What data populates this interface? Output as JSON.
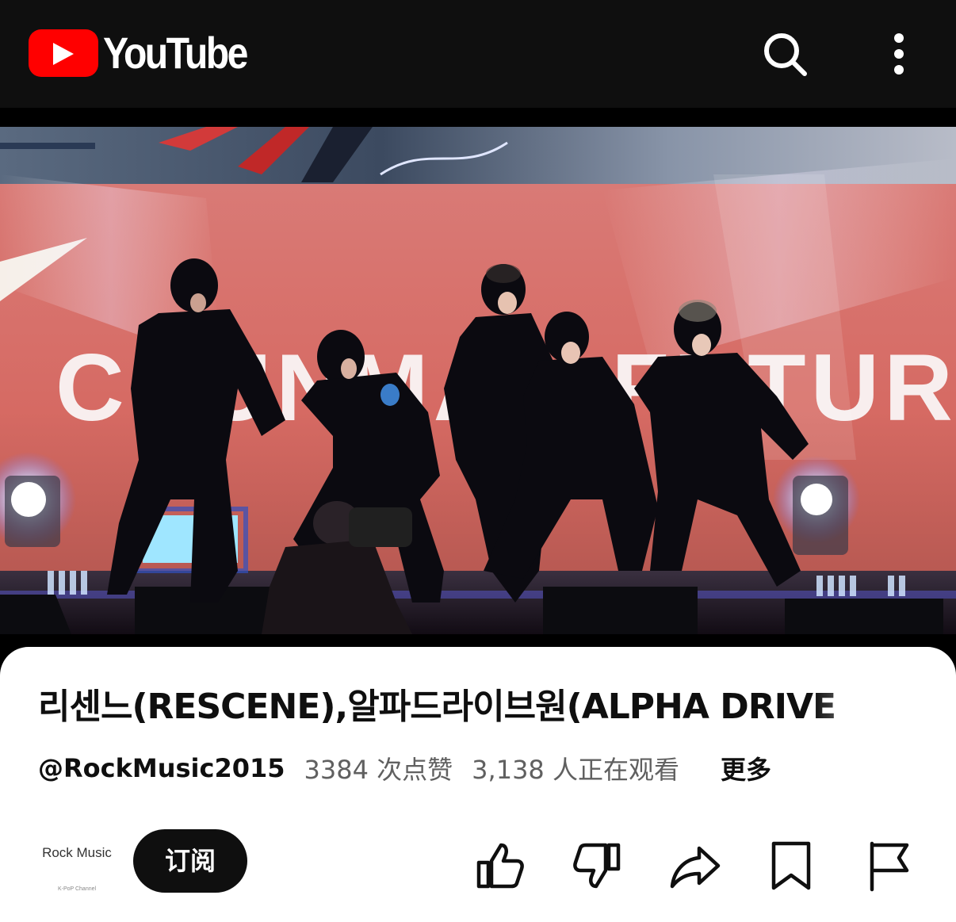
{
  "header": {
    "logo_text": "YouTube",
    "brand_color": "#ff0000",
    "icons": [
      "search-icon",
      "more-vert-icon"
    ]
  },
  "video": {
    "backdrop_text": "CHUNMAN FUTURE"
  },
  "details": {
    "title": "리센느(RESCENE),알파드라이브원(ALPHA DRIVE",
    "channel_handle": "@RockMusic2015",
    "likes": "3384 次点赞",
    "watching": "3,138 人正在观看",
    "more_label": "更多"
  },
  "channel": {
    "avatar_title": "Rock Music",
    "avatar_subtitle": "K-PoP Channel",
    "subscribe_label": "订阅"
  },
  "actions": {
    "icons": [
      "like-icon",
      "dislike-icon",
      "share-icon",
      "save-icon",
      "report-icon"
    ]
  }
}
